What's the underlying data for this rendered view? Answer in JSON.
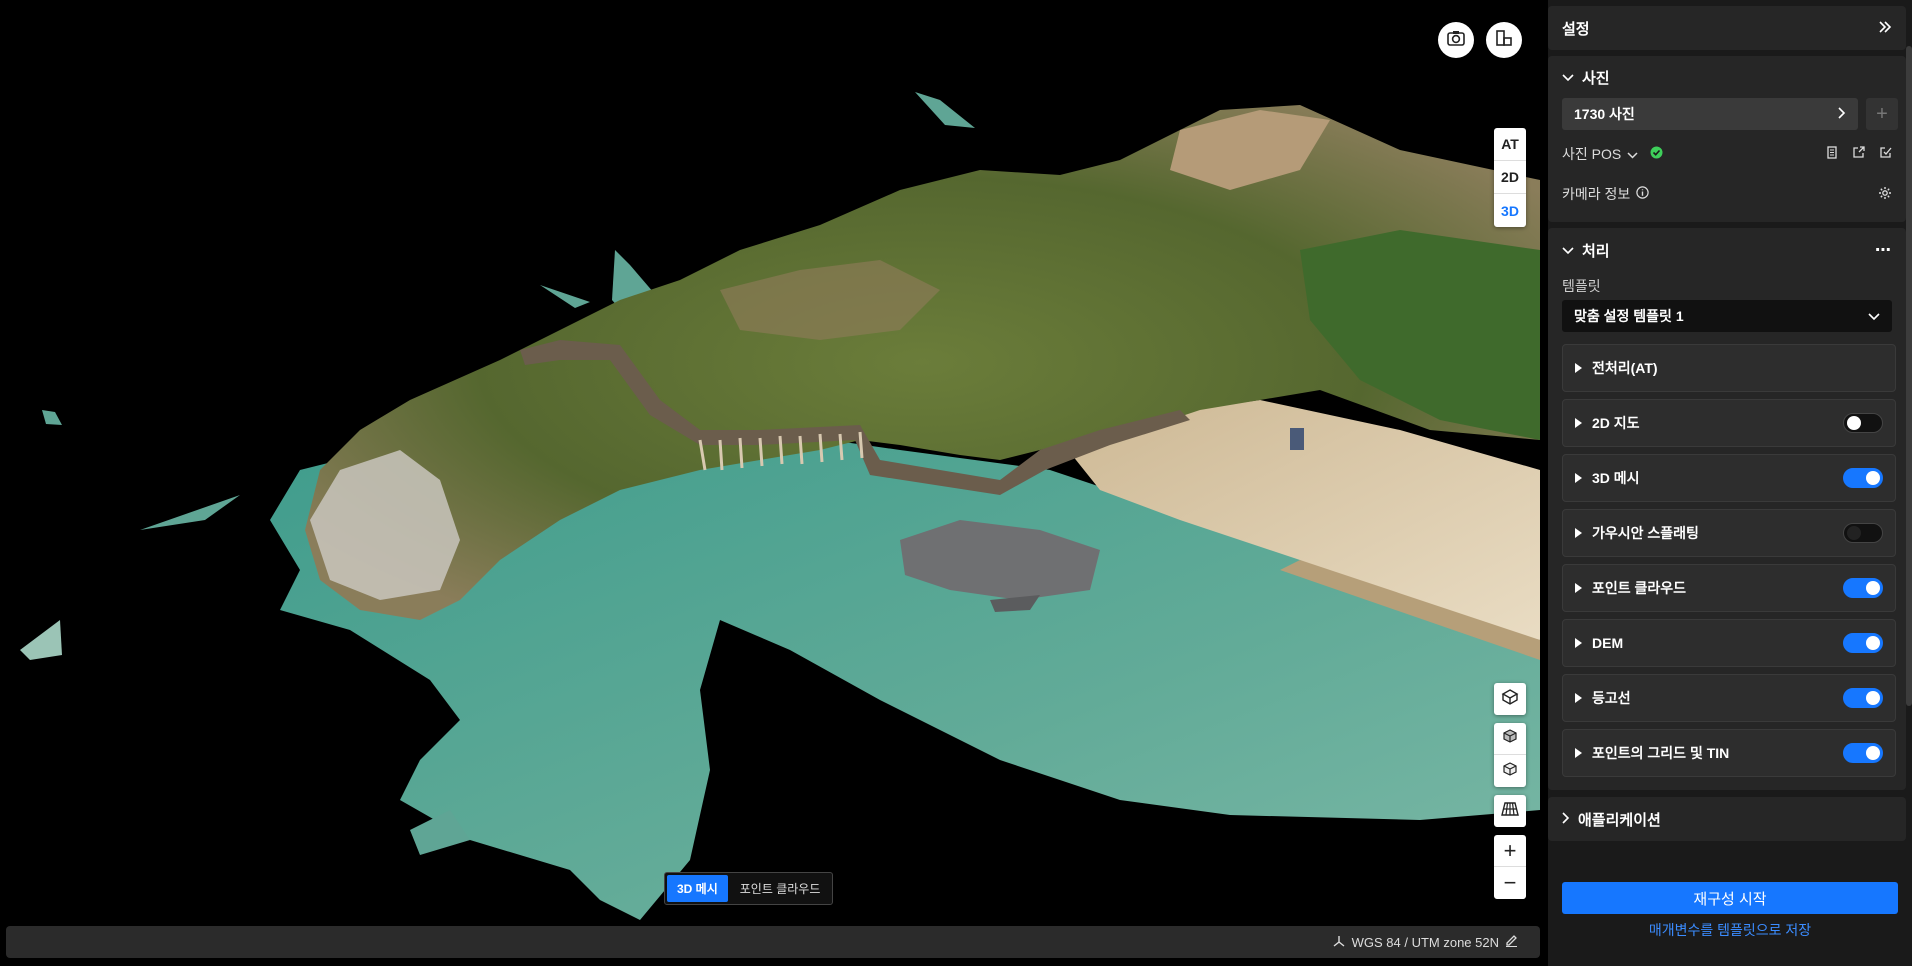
{
  "viewport": {
    "view_modes": [
      "AT",
      "2D",
      "3D"
    ],
    "active_view": "3D",
    "layer_switch": {
      "mesh": "3D 메시",
      "point_cloud": "포인트 클라우드"
    },
    "status_bar": {
      "crs": "WGS 84 / UTM zone 52N"
    },
    "icons": [
      "camera-icon",
      "floorplan-icon",
      "layers-cube-icon",
      "box-icon",
      "box-icon",
      "grid-floor-icon",
      "zoom-in-icon",
      "zoom-out-icon",
      "crs-axis-icon",
      "edit-icon"
    ],
    "zoom": {
      "in": "+",
      "out": "−"
    }
  },
  "panel": {
    "title": "설정",
    "photos": {
      "title": "사진",
      "count_label": "1730 사진",
      "add": "+",
      "pos_label": "사진 POS",
      "camera_info": "카메라 정보"
    },
    "processing": {
      "title": "처리",
      "template_label": "템플릿",
      "template_value": "맞춤 설정 템플릿 1",
      "items": [
        {
          "label": "전처리(AT)",
          "toggle": null
        },
        {
          "label": "2D 지도",
          "toggle": "off"
        },
        {
          "label": "3D 메시",
          "toggle": "on"
        },
        {
          "label": "가우시안 스플래팅",
          "toggle": "off-dim"
        },
        {
          "label": "포인트 클라우드",
          "toggle": "on"
        },
        {
          "label": "DEM",
          "toggle": "on"
        },
        {
          "label": "등고선",
          "toggle": "on"
        },
        {
          "label": "포인트의 그리드 및 TIN",
          "toggle": "on"
        }
      ]
    },
    "applications": {
      "title": "애플리케이션"
    },
    "start_button": "재구성 시작",
    "save_link": "매개변수를 템플릿으로 저장"
  },
  "colors": {
    "accent": "#1677ff",
    "water": "#5fa595",
    "success": "#3ecf5a"
  }
}
